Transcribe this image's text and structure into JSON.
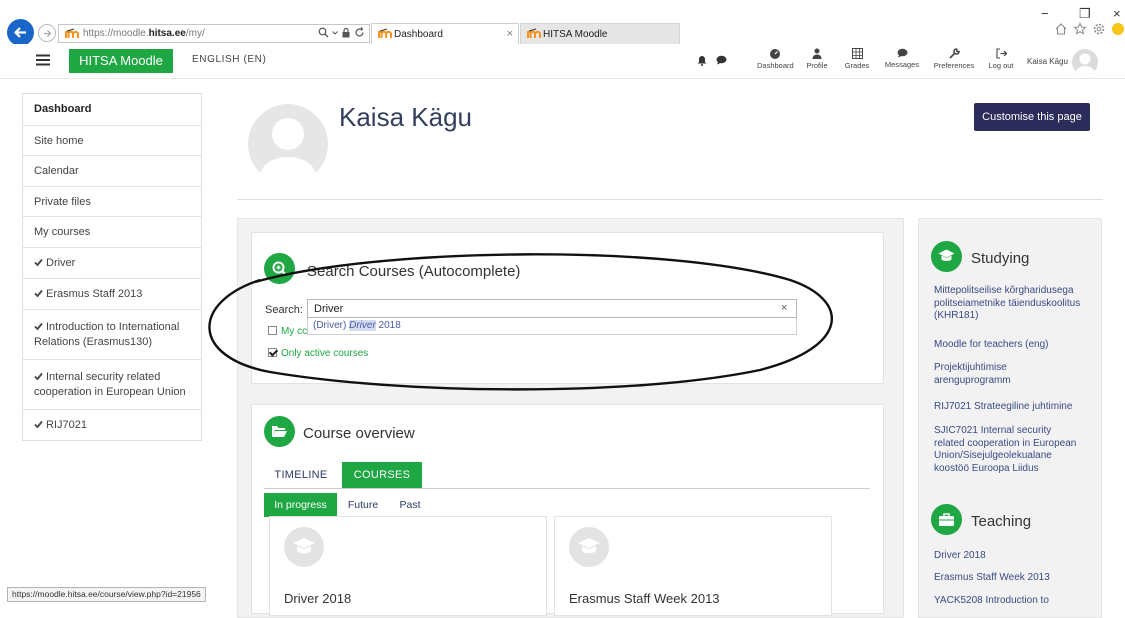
{
  "browser": {
    "url_prefix": "https://moodle.",
    "url_domain": "hitsa.ee",
    "url_path": "/my/",
    "tabs": [
      {
        "title": "Dashboard"
      },
      {
        "title": "HITSA Moodle"
      }
    ],
    "tab_close": "×",
    "win_minimize": "−",
    "win_restore": "❐",
    "win_close": "×",
    "status_url": "https://moodle.hitsa.ee/course/view.php?id=21956"
  },
  "navbar": {
    "site_name": "HITSA Moodle",
    "language": "ENGLISH (EN)",
    "items": [
      {
        "label": "Dashboard",
        "icon": "dashboard-icon"
      },
      {
        "label": "Profile",
        "icon": "user-icon"
      },
      {
        "label": "Grades",
        "icon": "grades-icon"
      },
      {
        "label": "Messages",
        "icon": "messages-icon"
      },
      {
        "label": "Preferences",
        "icon": "wrench-icon"
      },
      {
        "label": "Log out",
        "icon": "logout-icon"
      }
    ],
    "user_name": "Kaisa Kägu"
  },
  "leftnav": {
    "items": [
      {
        "label": "Dashboard"
      },
      {
        "label": "Site home"
      },
      {
        "label": "Calendar"
      },
      {
        "label": "Private files"
      },
      {
        "label": "My courses"
      }
    ],
    "courses": [
      {
        "label": "Driver"
      },
      {
        "label": "Erasmus Staff 2013"
      },
      {
        "label_line1": "Introduction to International",
        "label_line2": "Relations (Erasmus130)"
      },
      {
        "label_line1": "Internal security related",
        "label_line2": "cooperation in European Union"
      },
      {
        "label": "RIJ7021"
      }
    ]
  },
  "page": {
    "title": "Kaisa Kägu",
    "customise_label": "Customise this page"
  },
  "search_block": {
    "title": "Search Courses (Autocomplete)",
    "search_label": "Search:",
    "search_value": "Driver",
    "clear_label": "×",
    "suggestion_prefix": "(Driver) ",
    "suggestion_match": "Driver",
    "suggestion_suffix": " 2018",
    "my_courses_label": "My cc",
    "only_active_label": "Only active courses"
  },
  "course_overview": {
    "title": "Course overview",
    "tabs": [
      {
        "label": "TIMELINE"
      },
      {
        "label": "COURSES"
      }
    ],
    "filters": [
      {
        "label": "In progress"
      },
      {
        "label": "Future"
      },
      {
        "label": "Past"
      }
    ],
    "cards": [
      {
        "name": "Driver 2018"
      },
      {
        "name": "Erasmus Staff Week 2013"
      }
    ]
  },
  "studying": {
    "title": "Studying",
    "links": [
      {
        "l1": "Mittepolitseilise kõrgharidusega",
        "l2": "politseiametnike täienduskoolitus",
        "l3": "(KHR181)"
      },
      {
        "l1": "Moodle for teachers (eng)"
      },
      {
        "l1": "Projektijuhtimise",
        "l2": "arenguprogramm"
      },
      {
        "l1": "RIJ7021 Strateegiline juhtimine"
      },
      {
        "l1": "SJIC7021 Internal security",
        "l2": "related cooperation in European",
        "l3": "Union/Sisejulgeolekualane",
        "l4": "koostöö Euroopa Liidus"
      }
    ]
  },
  "teaching": {
    "title": "Teaching",
    "links": [
      {
        "l1": "Driver 2018"
      },
      {
        "l1": "Erasmus Staff Week 2013"
      },
      {
        "l1": "YACK5208 Introduction to"
      }
    ]
  },
  "colors": {
    "brand_green": "#1ea743",
    "dark_button": "#2c2c5a",
    "link_blue": "#3a4a86"
  }
}
